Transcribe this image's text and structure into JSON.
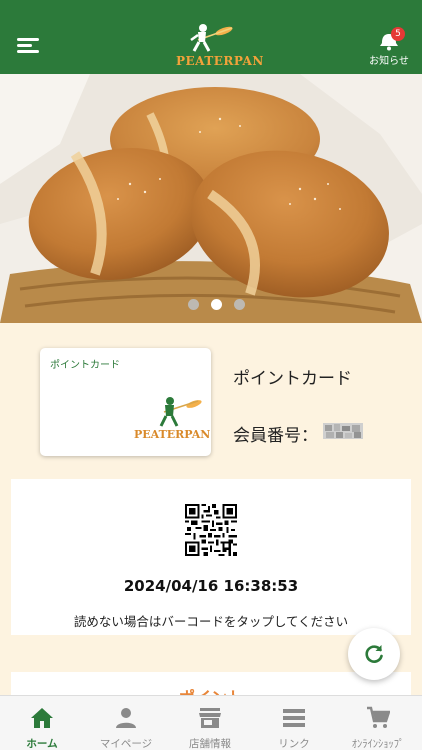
{
  "header": {
    "logo_text": "PEATERPAN",
    "notice_label": "お知らせ",
    "notice_badge": "5",
    "accent": "#2c7a3a"
  },
  "carousel": {
    "slides": 3,
    "active_index": 1
  },
  "point_card": {
    "card_title": "ポイントカード",
    "card_brand": "PEATERPAN",
    "heading": "ポイントカード",
    "member_label": "会員番号："
  },
  "qr": {
    "timestamp": "2024/04/16 16:38:53",
    "hint": "読めない場合はバーコードをタップしてください"
  },
  "points": {
    "title": "ポイント"
  },
  "tabs": [
    {
      "label": "ホーム",
      "icon": "home-icon"
    },
    {
      "label": "マイページ",
      "icon": "person-icon"
    },
    {
      "label": "店舗情報",
      "icon": "store-icon"
    },
    {
      "label": "リンク",
      "icon": "list-icon"
    },
    {
      "label": "ｵﾝﾗｲﾝｼｮｯﾌﾟ",
      "icon": "cart-icon"
    }
  ]
}
